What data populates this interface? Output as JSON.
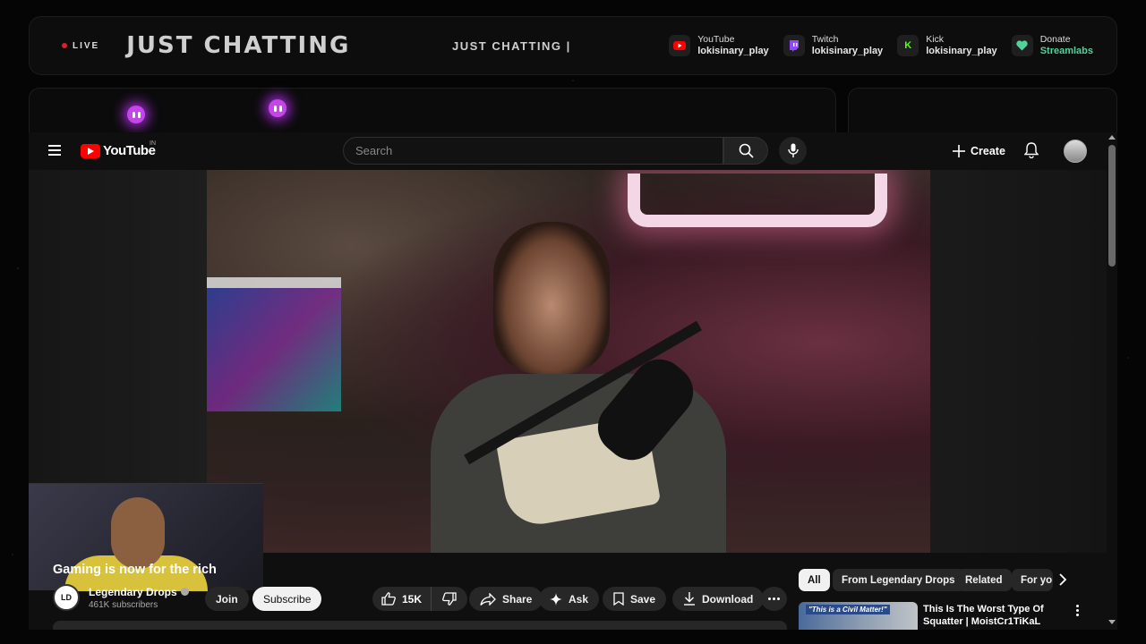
{
  "overlay": {
    "live_label": "LIVE",
    "title": "JUST CHATTING",
    "ticker": "JUST CHATTING |",
    "socials": [
      {
        "platform": "YouTube",
        "handle": "lokisinary_play",
        "icon": "youtube-icon",
        "color": "#ff0000"
      },
      {
        "platform": "Twitch",
        "handle": "lokisinary_play",
        "icon": "twitch-icon",
        "color": "#9146ff"
      },
      {
        "platform": "Kick",
        "handle": "lokisinary_play",
        "icon": "kick-icon",
        "glyph": "K",
        "color": "#53fc18"
      },
      {
        "platform": "Donate",
        "handle": "Streamlabs",
        "icon": "heart-icon",
        "color": "#53d19b"
      }
    ]
  },
  "youtube": {
    "logo_text": "YouTube",
    "region": "IN",
    "search": {
      "placeholder": "Search"
    },
    "create_label": "Create",
    "video": {
      "title": "Gaming is now for the rich",
      "channel_name": "Legendary Drops",
      "channel_initials": "LD",
      "subscribers": "461K subscribers",
      "join_label": "Join",
      "subscribe_label": "Subscribe",
      "likes": "15K",
      "share_label": "Share",
      "ask_label": "Ask",
      "save_label": "Save",
      "download_label": "Download"
    },
    "chips": [
      "All",
      "From Legendary Drops",
      "Related",
      "For yo"
    ],
    "recommendation": {
      "thumb_caption": "\"This is a Civil Matter!\"",
      "title": "This Is The Worst Type Of Squatter | MoistCr1TiKaL"
    }
  },
  "colors": {
    "accent_red": "#ff0000",
    "ghost_purple": "#c546e8",
    "streamlabs_green": "#53d19b"
  }
}
